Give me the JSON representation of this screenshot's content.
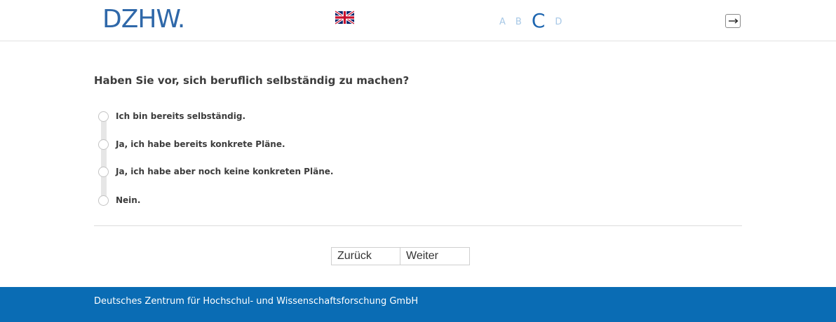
{
  "header": {
    "logo_text": "DZHW.",
    "language_flag": "uk-flag-icon",
    "progress_steps": [
      "A",
      "B",
      "C",
      "D"
    ],
    "active_step": "C",
    "logout_icon": "logout-arrow-icon"
  },
  "question": {
    "text": "Haben Sie vor, sich beruflich selbständig zu machen?",
    "options": [
      "Ich bin bereits selbständig.",
      "Ja, ich habe bereits konkrete Pläne.",
      "Ja, ich habe aber noch keine konkreten Pläne.",
      "Nein."
    ]
  },
  "navigation": {
    "back_label": "Zurück",
    "next_label": "Weiter"
  },
  "footer": {
    "text": "Deutsches Zentrum für Hochschul- und Wissenschaftsforschung GmbH"
  },
  "colors": {
    "brand_blue": "#2f68a9",
    "footer_blue": "#0a6cb4",
    "step_inactive": "#a7c8e6",
    "step_active": "#1e66b0"
  }
}
